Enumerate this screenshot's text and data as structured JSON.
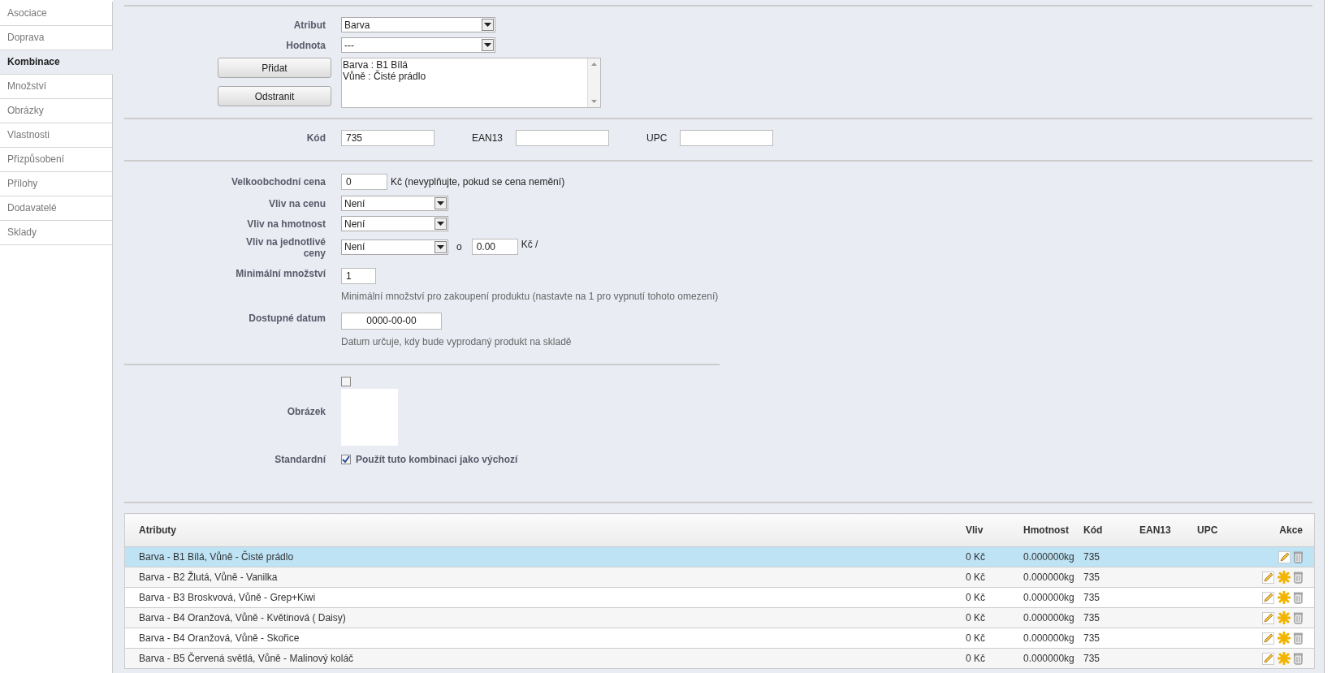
{
  "sidebar": {
    "items": [
      {
        "label": "Asociace",
        "selected": false
      },
      {
        "label": "Doprava",
        "selected": false
      },
      {
        "label": "Kombinace",
        "selected": true
      },
      {
        "label": "Množství",
        "selected": false
      },
      {
        "label": "Obrázky",
        "selected": false
      },
      {
        "label": "Vlastnosti",
        "selected": false
      },
      {
        "label": "Přizpůsobení",
        "selected": false
      },
      {
        "label": "Přílohy",
        "selected": false
      },
      {
        "label": "Dodavatelé",
        "selected": false
      },
      {
        "label": "Sklady",
        "selected": false
      }
    ]
  },
  "attribute_section": {
    "attribute": {
      "label": "Atribut",
      "value": "Barva"
    },
    "value": {
      "label": "Hodnota",
      "value": "---"
    },
    "add_button": "Přidat",
    "remove_button": "Odstranit",
    "selected_values": [
      "Barva : B1 Bílá",
      "Vůně : Čisté prádlo"
    ]
  },
  "codes": [
    {
      "label": "Kód",
      "value": "735"
    },
    {
      "label": "EAN13"
    },
    {
      "label": "UPC"
    }
  ],
  "pricing": {
    "wholesale": {
      "label": "Velkoobchodní cena",
      "value": "0",
      "note": "Kč (nevyplňujte, pokud se cena nemění)"
    },
    "price_impact": {
      "label": "Vliv na cenu",
      "value": "Není"
    },
    "weight_impact": {
      "label": "Vliv na hmotnost",
      "value": "Není"
    },
    "unit_price_impact": {
      "label": "Vliv na jednotlivé ceny",
      "value": "Není",
      "by": "o",
      "amount": "0.00",
      "unit": "Kč /"
    },
    "min_quantity": {
      "label": "Minimální množství",
      "value": "1",
      "help": "Minimální množství pro zakoupení produktu (nastavte na 1 pro vypnutí tohoto omezení)"
    },
    "available_date": {
      "label": "Dostupné datum",
      "value": "0000-00-00",
      "help": "Datum určuje, kdy bude vyprodaný produkt na skladě"
    }
  },
  "image": {
    "label": "Obrázek",
    "checked": false
  },
  "default": {
    "label": "Standardní",
    "text": "Použít tuto kombinaci jako výchozí",
    "checked": true
  },
  "table": {
    "columns": [
      "Atributy",
      "Vliv",
      "Hmotnost",
      "Kód",
      "EAN13",
      "UPC",
      "Akce"
    ],
    "rows": [
      {
        "attributes": "Barva - B1 Bílá, Vůně - Čisté prádlo",
        "impact": "0 Kč",
        "weight": "0.000000kg",
        "code": "735",
        "selected": true,
        "default": true
      },
      {
        "attributes": "Barva - B2 Žlutá, Vůně - Vanilka",
        "impact": "0 Kč",
        "weight": "0.000000kg",
        "code": "735",
        "selected": false,
        "default": false
      },
      {
        "attributes": "Barva - B3 Broskvová, Vůně - Grep+Kiwi",
        "impact": "0 Kč",
        "weight": "0.000000kg",
        "code": "735",
        "selected": false,
        "default": false
      },
      {
        "attributes": "Barva - B4 Oranžová, Vůně - Květinová ( Daisy)",
        "impact": "0 Kč",
        "weight": "0.000000kg",
        "code": "735",
        "selected": false,
        "default": false
      },
      {
        "attributes": "Barva - B4 Oranžová, Vůně - Skořice",
        "impact": "0 Kč",
        "weight": "0.000000kg",
        "code": "735",
        "selected": false,
        "default": false
      },
      {
        "attributes": "Barva - B5 Červená světlá, Vůně - Malinový koláč",
        "impact": "0 Kč",
        "weight": "0.000000kg",
        "code": "735",
        "selected": false,
        "default": false
      }
    ]
  }
}
